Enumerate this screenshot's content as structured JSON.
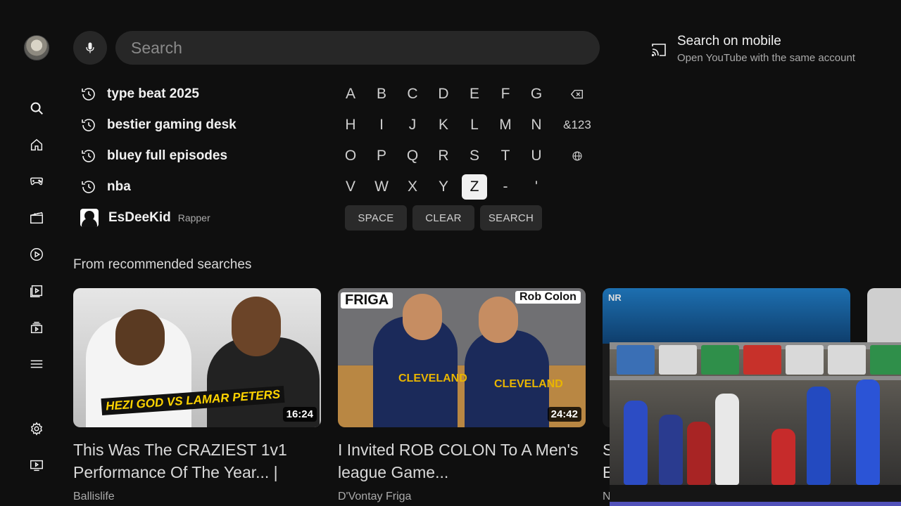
{
  "search": {
    "placeholder": "Search"
  },
  "mobile": {
    "title": "Search on mobile",
    "subtitle": "Open YouTube with the same account"
  },
  "suggestions": [
    {
      "text": "type beat 2025",
      "icon": "history-icon"
    },
    {
      "text": "bestier gaming desk",
      "icon": "history-icon"
    },
    {
      "text": "bluey full episodes",
      "icon": "history-icon"
    },
    {
      "text": "nba",
      "icon": "history-icon"
    },
    {
      "text": "EsDeeKid",
      "sub": "Rapper",
      "icon": "person-thumbnail"
    }
  ],
  "keyboard": {
    "rows": [
      [
        "A",
        "B",
        "C",
        "D",
        "E",
        "F",
        "G"
      ],
      [
        "H",
        "I",
        "J",
        "K",
        "L",
        "M",
        "N"
      ],
      [
        "O",
        "P",
        "Q",
        "R",
        "S",
        "T",
        "U"
      ],
      [
        "V",
        "W",
        "X",
        "Y",
        "Z",
        "-",
        "'"
      ]
    ],
    "selected": "Z",
    "symbols_label": "&123",
    "space_label": "SPACE",
    "clear_label": "CLEAR",
    "search_label": "SEARCH"
  },
  "recommended": {
    "title": "From recommended searches",
    "cards": [
      {
        "title": "This Was The CRAZIEST 1v1 Performance Of The Year... |",
        "channel": "Ballislife",
        "duration": "16:24",
        "thumb_banner": "HEZI GOD VS LAMAR PETERS"
      },
      {
        "title": "I Invited ROB COLON To A Men's league Game...",
        "channel": "D'Vontay Friga",
        "duration": "24:42",
        "thumb_label_left": "FRIGA",
        "thumb_label_right": "Rob Colon",
        "jersey_left": "CLEVELAND",
        "jersey_right": "CLEVELAND"
      },
      {
        "title_fragment_1": "S",
        "title_fragment_2": "E",
        "channel_fragment": "N",
        "thumb_logo": "NR"
      }
    ]
  }
}
